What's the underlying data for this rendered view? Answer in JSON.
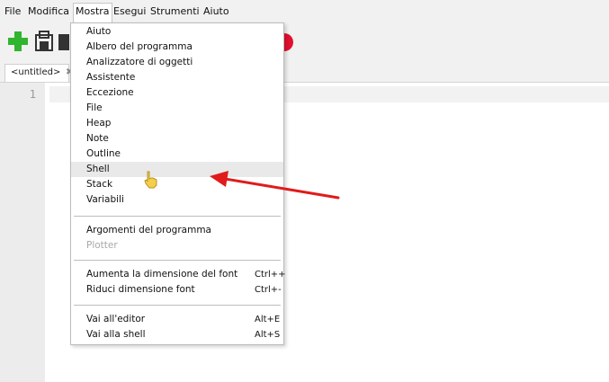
{
  "menubar": {
    "items": [
      "File",
      "Modifica",
      "Mostra",
      "Esegui",
      "Strumenti",
      "Aiuto"
    ]
  },
  "tab": {
    "label": "<untitled>"
  },
  "editor": {
    "line_number": "1"
  },
  "view_menu": {
    "items": [
      {
        "label": "Aiuto"
      },
      {
        "label": "Albero del programma"
      },
      {
        "label": "Analizzatore di oggetti"
      },
      {
        "label": "Assistente"
      },
      {
        "label": "Eccezione"
      },
      {
        "label": "File"
      },
      {
        "label": "Heap"
      },
      {
        "label": "Note"
      },
      {
        "label": "Outline"
      },
      {
        "label": "Shell"
      },
      {
        "label": "Stack"
      },
      {
        "label": "Variabili"
      }
    ],
    "group2": [
      {
        "label": "Argomenti del programma"
      },
      {
        "label": "Plotter"
      }
    ],
    "group3": [
      {
        "label": "Aumenta la dimensione del font",
        "shortcut": "Ctrl++"
      },
      {
        "label": "Riduci dimensione font",
        "shortcut": "Ctrl+-"
      }
    ],
    "group4": [
      {
        "label": "Vai all'editor",
        "shortcut": "Alt+E"
      },
      {
        "label": "Vai alla shell",
        "shortcut": "Alt+S"
      }
    ]
  },
  "colors": {
    "annotation_arrow": "#e01b1b",
    "new_icon": "#2fb52f",
    "cursor": "#f3cf4a"
  },
  "icons": [
    "plus-icon",
    "save-icon",
    "stop-icon",
    "hand-cursor-icon",
    "arrow-annotation"
  ]
}
